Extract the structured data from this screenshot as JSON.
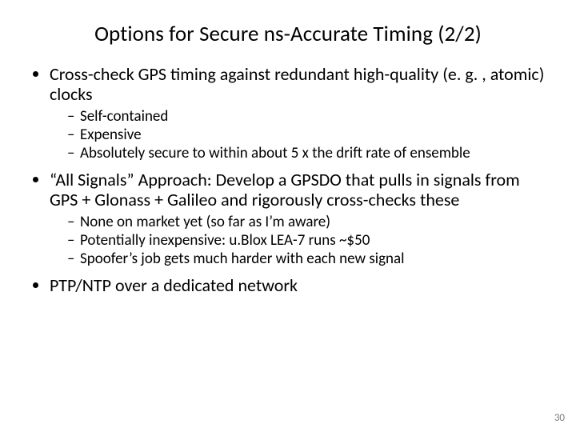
{
  "title": "Options for Secure ns-Accurate Timing (2/2)",
  "bullets": [
    {
      "text": "Cross-check GPS timing against redundant high-quality (e. g. , atomic) clocks",
      "sub": [
        "Self-contained",
        "Expensive",
        "Absolutely secure to within about 5 x the drift rate of ensemble"
      ]
    },
    {
      "text": "“All Signals” Approach: Develop a GPSDO that pulls in signals from GPS + Glonass + Galileo and rigorously cross-checks these",
      "sub": [
        "None on market yet (so far as I’m aware)",
        "Potentially inexpensive: u.Blox LEA-7 runs ~$50",
        "Spoofer’s job gets much harder with each new signal"
      ]
    },
    {
      "text": "PTP/NTP over a dedicated network",
      "sub": []
    }
  ],
  "page_number": "30"
}
